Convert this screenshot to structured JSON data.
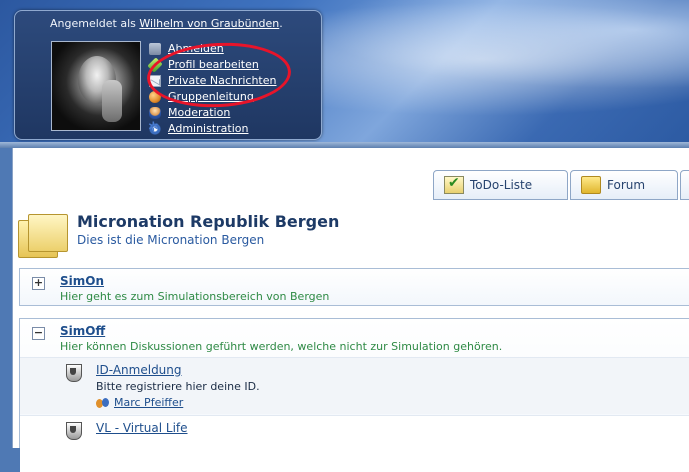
{
  "header": {
    "login_prefix": "Angemeldet als ",
    "username": "Wilhelm von Graubünden",
    "login_suffix": ".",
    "menu": [
      {
        "label": "Abmelden",
        "icon": "logout-icon"
      },
      {
        "label": "Profil bearbeiten",
        "icon": "pencil-icon"
      },
      {
        "label": "Private Nachrichten",
        "icon": "mail-icon"
      },
      {
        "label": "Gruppenleitung",
        "icon": "group-icon"
      },
      {
        "label": "Moderation",
        "icon": "moderator-icon"
      },
      {
        "label": "Administration",
        "icon": "gear-icon"
      }
    ],
    "highlight_color": "#e8142a"
  },
  "tabs": [
    {
      "label": "ToDo-Liste",
      "icon": "todo-icon"
    },
    {
      "label": "Forum",
      "icon": "folder-icon"
    }
  ],
  "forum": {
    "title": "Micronation Republik Bergen",
    "description": "Dies ist die Micronation Bergen"
  },
  "categories": [
    {
      "name": "SimOn",
      "toggle": "+",
      "description": "Hier geht es zum Simulationsbereich von Bergen"
    },
    {
      "name": "SimOff",
      "toggle": "−",
      "description": "Hier können Diskussionen geführt werden, welche nicht zur Simulation gehören.",
      "boards": [
        {
          "name": "ID-Anmeldung",
          "description": "Bitte registriere hier deine ID.",
          "moderator": "Marc Pfeiffer"
        },
        {
          "name": "VL - Virtual Life"
        }
      ]
    }
  ],
  "colors": {
    "header_blue": "#3f73c0",
    "link_blue": "#1e4e8c",
    "category_desc_green": "#2e8a44"
  }
}
